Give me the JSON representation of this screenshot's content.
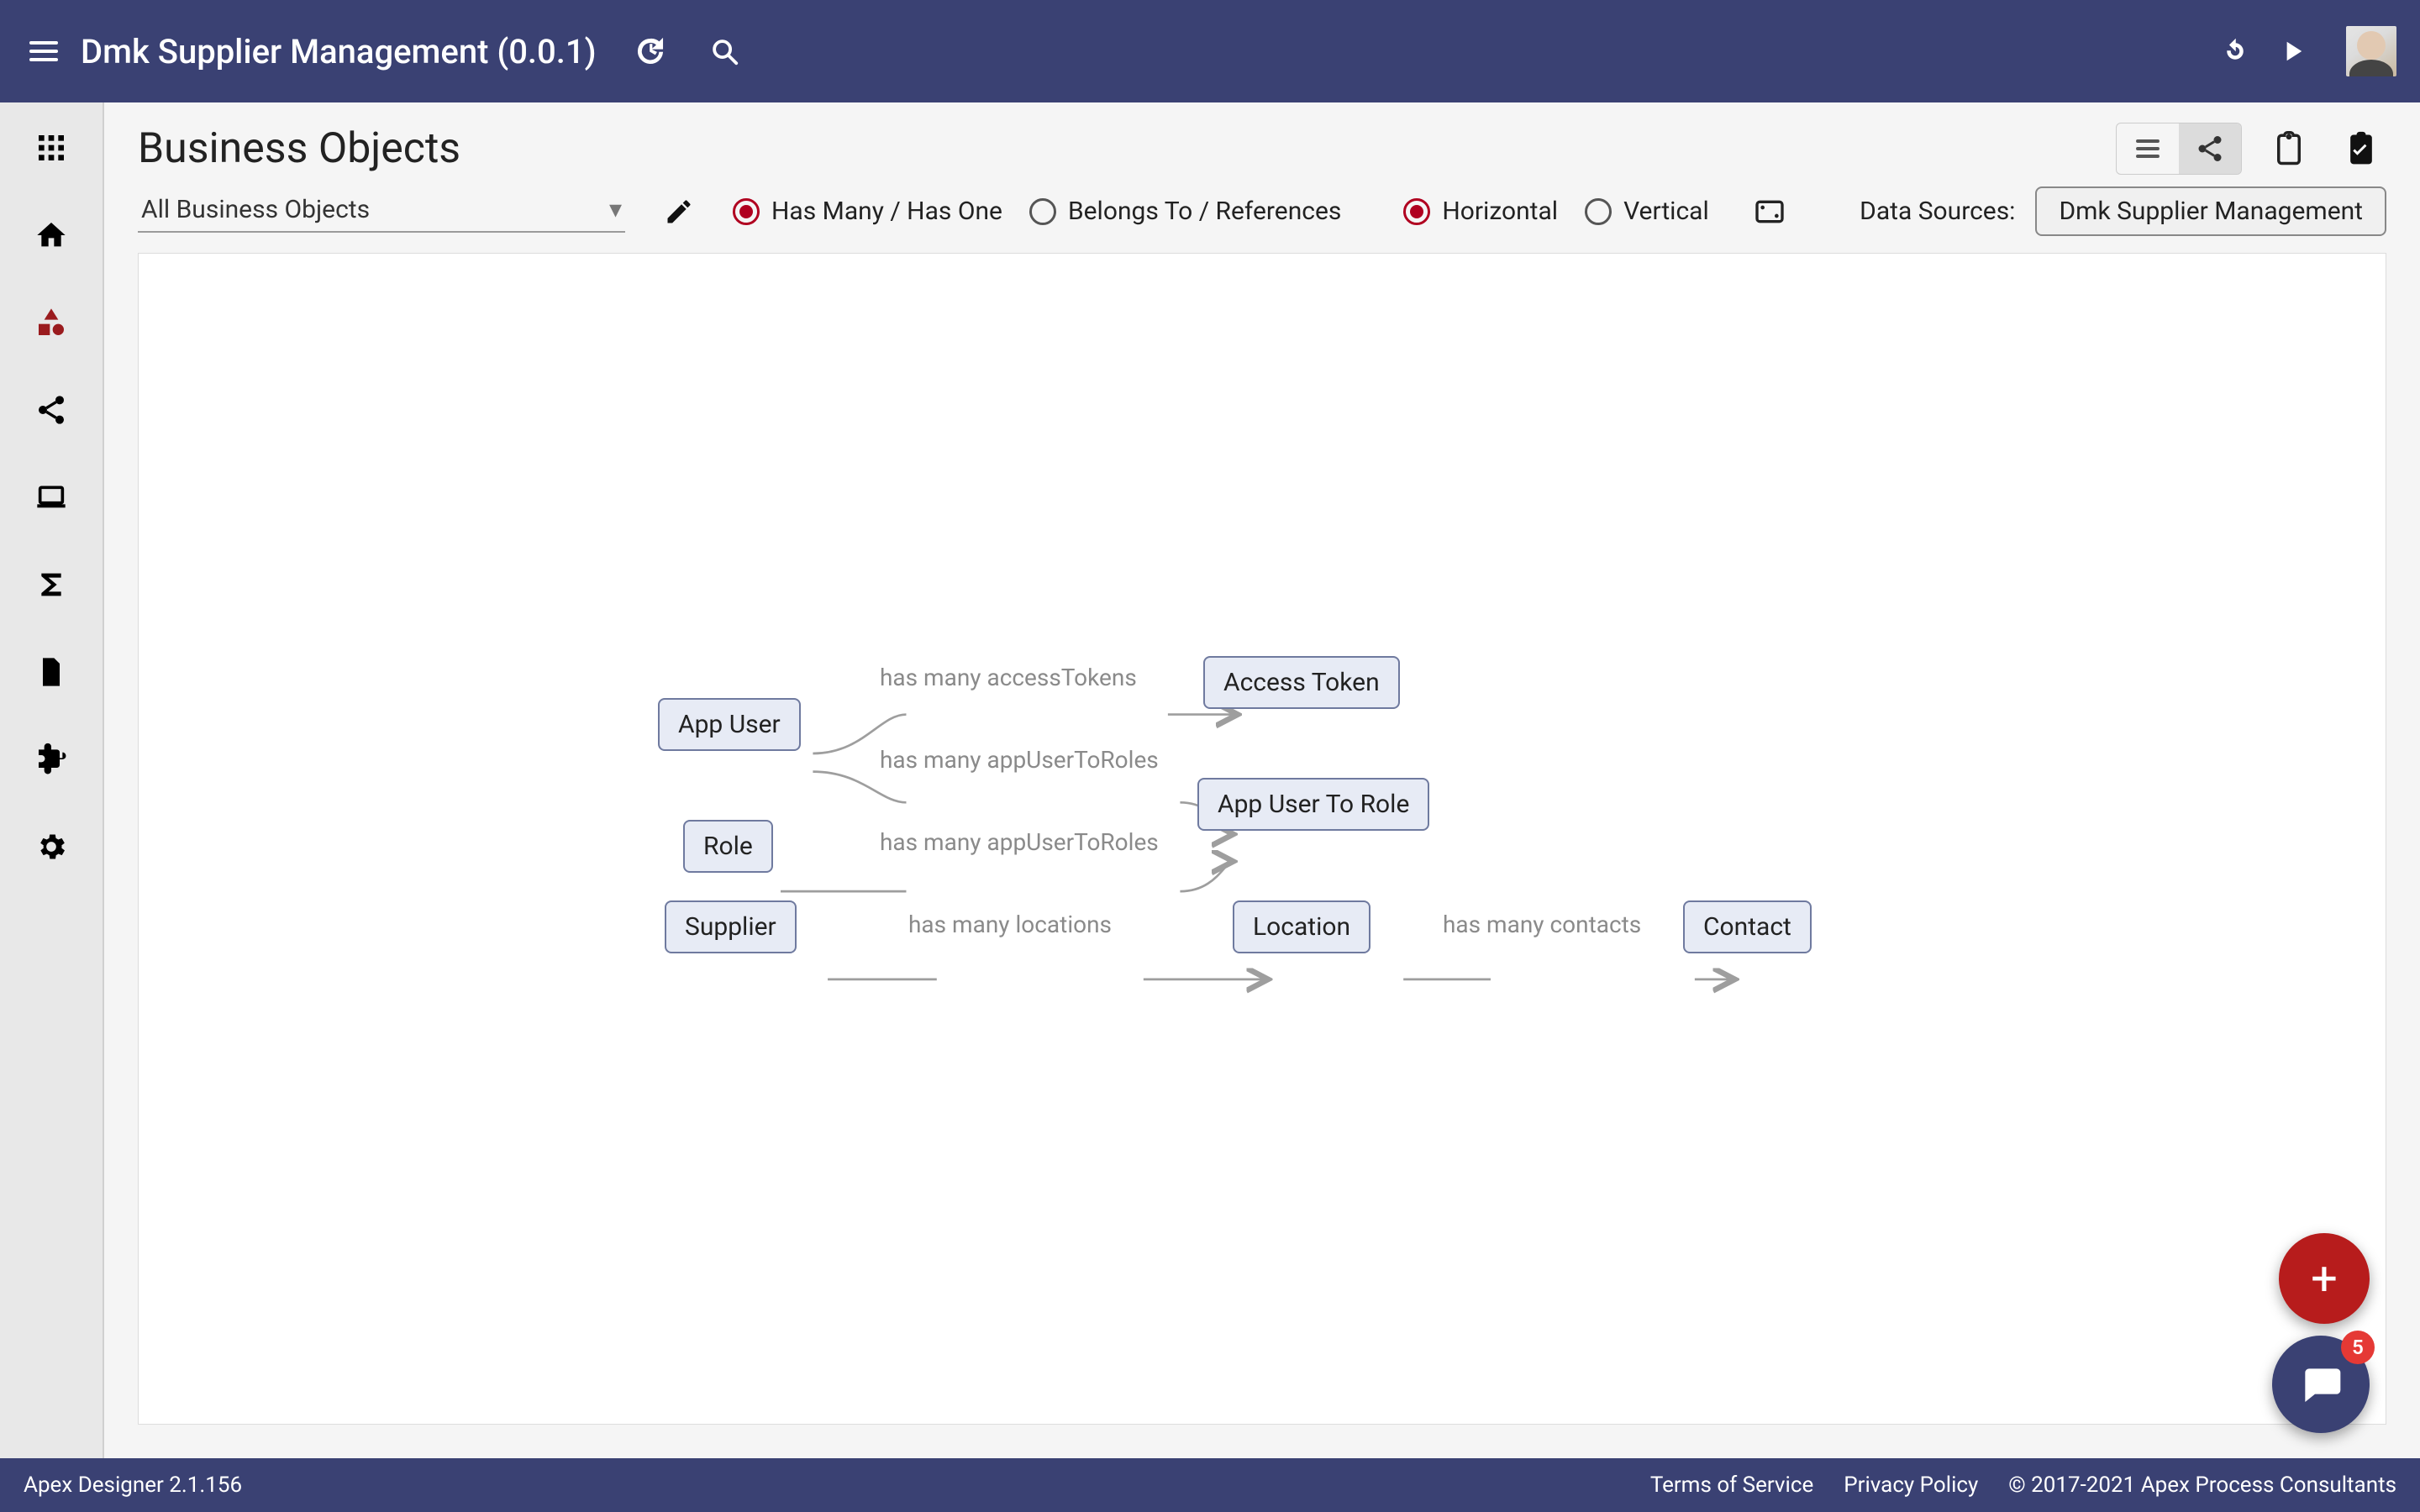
{
  "header": {
    "title": "Dmk Supplier Management (0.0.1)"
  },
  "page": {
    "heading": "Business Objects",
    "view_list": "list",
    "view_graph": "graph"
  },
  "dropdown": {
    "selected": "All Business Objects"
  },
  "relationship_radio": {
    "has_many": "Has Many / Has One",
    "belongs_to": "Belongs To / References"
  },
  "orientation_radio": {
    "horizontal": "Horizontal",
    "vertical": "Vertical"
  },
  "data_sources": {
    "label": "Data Sources:",
    "chip": "Dmk Supplier Management"
  },
  "nodes": {
    "app_user": "App User",
    "access_token": "Access Token",
    "app_user_to_role": "App User To Role",
    "role": "Role",
    "supplier": "Supplier",
    "location": "Location",
    "contact": "Contact"
  },
  "edges": {
    "e1": "has many accessTokens",
    "e2": "has many appUserToRoles",
    "e3": "has many appUserToRoles",
    "e4": "has many locations",
    "e5": "has many contacts"
  },
  "fab": {
    "plus": "+"
  },
  "chat": {
    "badge": "5"
  },
  "footer": {
    "app_version": "Apex Designer 2.1.156",
    "terms": "Terms of Service",
    "privacy": "Privacy Policy",
    "copyright": "© 2017-2021 Apex Process Consultants"
  }
}
